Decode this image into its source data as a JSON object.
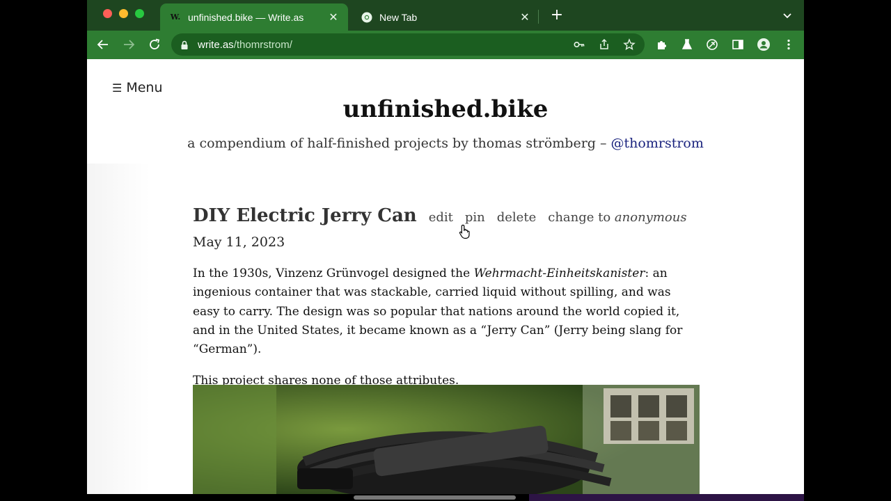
{
  "browser": {
    "tabs": [
      {
        "title": "unfinished.bike — Write.as",
        "favicon": "W.",
        "active": true
      },
      {
        "title": "New Tab",
        "favicon": "chrome-icon",
        "active": false
      }
    ],
    "url": {
      "host": "write.as",
      "path": "/thomrstrom/"
    },
    "colors": {
      "frame": "#1e4620",
      "toolbar": "#2e7d32"
    }
  },
  "page": {
    "menu_label": "Menu",
    "site_title": "unfinished.bike",
    "site_description": "a compendium of half-finished projects by thomas strömberg – ",
    "site_handle": "@thomrstrom",
    "post": {
      "title": "DIY Electric Jerry Can",
      "actions": {
        "edit": "edit",
        "pin": "pin",
        "delete": "delete",
        "change": "change to ",
        "anonymous": "anonymous"
      },
      "date": "May 11, 2023",
      "p1_a": "In the 1930s, Vinzenz Grünvogel designed the ",
      "p1_italic": "Wehrmacht-Einheitskanister",
      "p1_b": ": an ingenious container that was stackable, carried liquid without spilling, and was easy to carry. The design was so popular that nations around the world copied it, and in the United States, it became known as a “Jerry Can” (Jerry being slang for “German”).",
      "p2": "This project shares none of those attributes."
    }
  }
}
